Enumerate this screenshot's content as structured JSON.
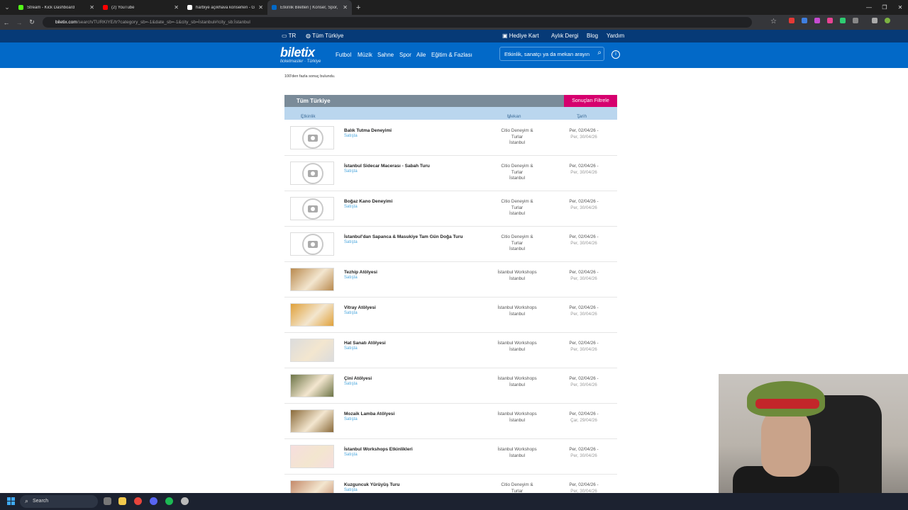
{
  "browser": {
    "tabs": [
      {
        "title": "Stream - Kick Dashboard",
        "fav": "#53fc18"
      },
      {
        "title": "(2) YouTube",
        "fav": "#ff0000"
      },
      {
        "title": "harbiye açıkhava konserleri - G",
        "fav": "#ffffff"
      },
      {
        "title": "Etkinlik Biletleri | Konser, Spor,",
        "fav": "#0269c8"
      }
    ],
    "url_host": "biletix.com",
    "url_rest": "/search/TURKIYE/tr?category_sb=-1&date_sb=-1&city_sb=İstanbul#!city_sb:İstanbul"
  },
  "site": {
    "top": {
      "lang": "TR",
      "region": "Tüm Türkiye",
      "gift": "Hediye Kart",
      "magazine": "Aylık Dergi",
      "blog": "Blog",
      "help": "Yardım"
    },
    "logo": "biletix",
    "logo_sub": "ticketmaster · Türkiye",
    "menu": [
      "Futbol",
      "Müzik",
      "Sahne",
      "Spor",
      "Aile",
      "Eğitim & Fazlası"
    ],
    "search_placeholder": "Etkinlik, sanatçı ya da mekan arayın",
    "results_count": "100'den fazla sonuç bulundu.",
    "panel_title": "Tüm Türkiye",
    "filter_button": "Sonuçları Filtrele",
    "col_event": "Etkinlik",
    "col_venue": "Mekan",
    "col_date": "Tarih"
  },
  "events": [
    {
      "name": "Balık Tutma Deneyimi",
      "status": "Satışta",
      "venue": [
        "Citio Deneyim &",
        "Turlar",
        "İstanbul"
      ],
      "date1": "Per, 02/04/26 -",
      "date2": "Per, 30/04/26",
      "thumb": "placeholder"
    },
    {
      "name": "İstanbul Sidecar Macerası - Sabah Turu",
      "status": "Satışta",
      "venue": [
        "Citio Deneyim &",
        "Turlar",
        "İstanbul"
      ],
      "date1": "Per, 02/04/26 -",
      "date2": "Per, 30/04/26",
      "thumb": "placeholder"
    },
    {
      "name": "Boğaz Kano Deneyimi",
      "status": "Satışta",
      "venue": [
        "Citio Deneyim &",
        "Turlar",
        "İstanbul"
      ],
      "date1": "Per, 02/04/26 -",
      "date2": "Per, 30/04/26",
      "thumb": "placeholder"
    },
    {
      "name": "İstanbul'dan Sapanca & Masukiye Tam Gün Doğa Turu",
      "status": "Satışta",
      "venue": [
        "Citio Deneyim &",
        "Turlar",
        "İstanbul"
      ],
      "date1": "Per, 02/04/26 -",
      "date2": "Per, 30/04/26",
      "thumb": "placeholder"
    },
    {
      "name": "Tezhip Atölyesi",
      "status": "Satışta",
      "venue": [
        "İstanbul Workshops",
        "İstanbul"
      ],
      "date1": "Per, 02/04/26 -",
      "date2": "Per, 30/04/26",
      "thumb": "#b98a4e"
    },
    {
      "name": "Vitray Atölyesi",
      "status": "Satışta",
      "venue": [
        "İstanbul Workshops",
        "İstanbul"
      ],
      "date1": "Per, 02/04/26 -",
      "date2": "Per, 30/04/26",
      "thumb": "#e0a13a"
    },
    {
      "name": "Hat Sanatı Atölyesi",
      "status": "Satışta",
      "venue": [
        "İstanbul Workshops",
        "İstanbul"
      ],
      "date1": "Per, 02/04/26 -",
      "date2": "Per, 30/04/26",
      "thumb": "#dcdcdc"
    },
    {
      "name": "Çini Atölyesi",
      "status": "Satışta",
      "venue": [
        "İstanbul Workshops",
        "İstanbul"
      ],
      "date1": "Per, 02/04/26 -",
      "date2": "Per, 30/04/26",
      "thumb": "#6c7446"
    },
    {
      "name": "Mozaik Lamba Atölyesi",
      "status": "Satışta",
      "venue": [
        "İstanbul Workshops",
        "İstanbul"
      ],
      "date1": "Per, 02/04/26 -",
      "date2": "Çar, 29/04/26",
      "thumb": "#8a6a3a"
    },
    {
      "name": "İstanbul Workshops Etkinlikleri",
      "status": "Satışta",
      "venue": [
        "İstanbul Workshops",
        "İstanbul"
      ],
      "date1": "Per, 02/04/26 -",
      "date2": "Per, 30/04/26",
      "thumb": "#f6dede"
    },
    {
      "name": "Kuzguncuk Yürüyüş Turu",
      "status": "Satışta",
      "venue": [
        "Citio Deneyim &",
        "Turlar"
      ],
      "date1": "Per, 02/04/26 -",
      "date2": "Per, 30/04/26",
      "thumb": "#c48a6a"
    }
  ],
  "taskbar": {
    "search": "Search"
  }
}
